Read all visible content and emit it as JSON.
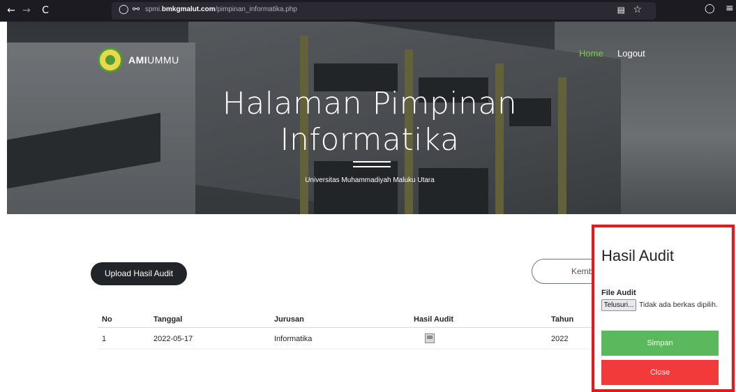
{
  "browser": {
    "back_icon": "←",
    "forward_icon": "→",
    "reload_icon": "C",
    "url_prefix": "spmi.",
    "url_domain": "bmkgmalut.com",
    "url_path": "/pimpinan_informatika.php"
  },
  "header": {
    "brand_bold": "AMI",
    "brand_rest": "UMMU",
    "nav": {
      "home": "Home",
      "logout": "Logout"
    },
    "title_line1": "Halaman Pimpinan",
    "title_line2": "Informatika",
    "subtitle": "Universitas Muhammadiyah Maluku Utara"
  },
  "main": {
    "upload_button": "Upload Hasil Audit",
    "back_button": "Kembali",
    "table": {
      "headers": [
        "No",
        "Tanggal",
        "Jurusan",
        "Hasil Audit",
        "Tahun"
      ],
      "rows": [
        {
          "no": "1",
          "tanggal": "2022-05-17",
          "jurusan": "Informatika",
          "hasil_audit": "image-icon",
          "tahun": "2022"
        }
      ]
    }
  },
  "modal": {
    "title": "Hasil Audit",
    "field_label": "File Audit",
    "file_button": "Telusuri...",
    "file_status": "Tidak ada berkas dipilih.",
    "save_button": "Simpan",
    "close_button": "Close",
    "highlight_color": "#e01b1b"
  },
  "colors": {
    "save": "#5cb85c",
    "close": "#f23a3a",
    "nav_active": "#7ec850"
  }
}
